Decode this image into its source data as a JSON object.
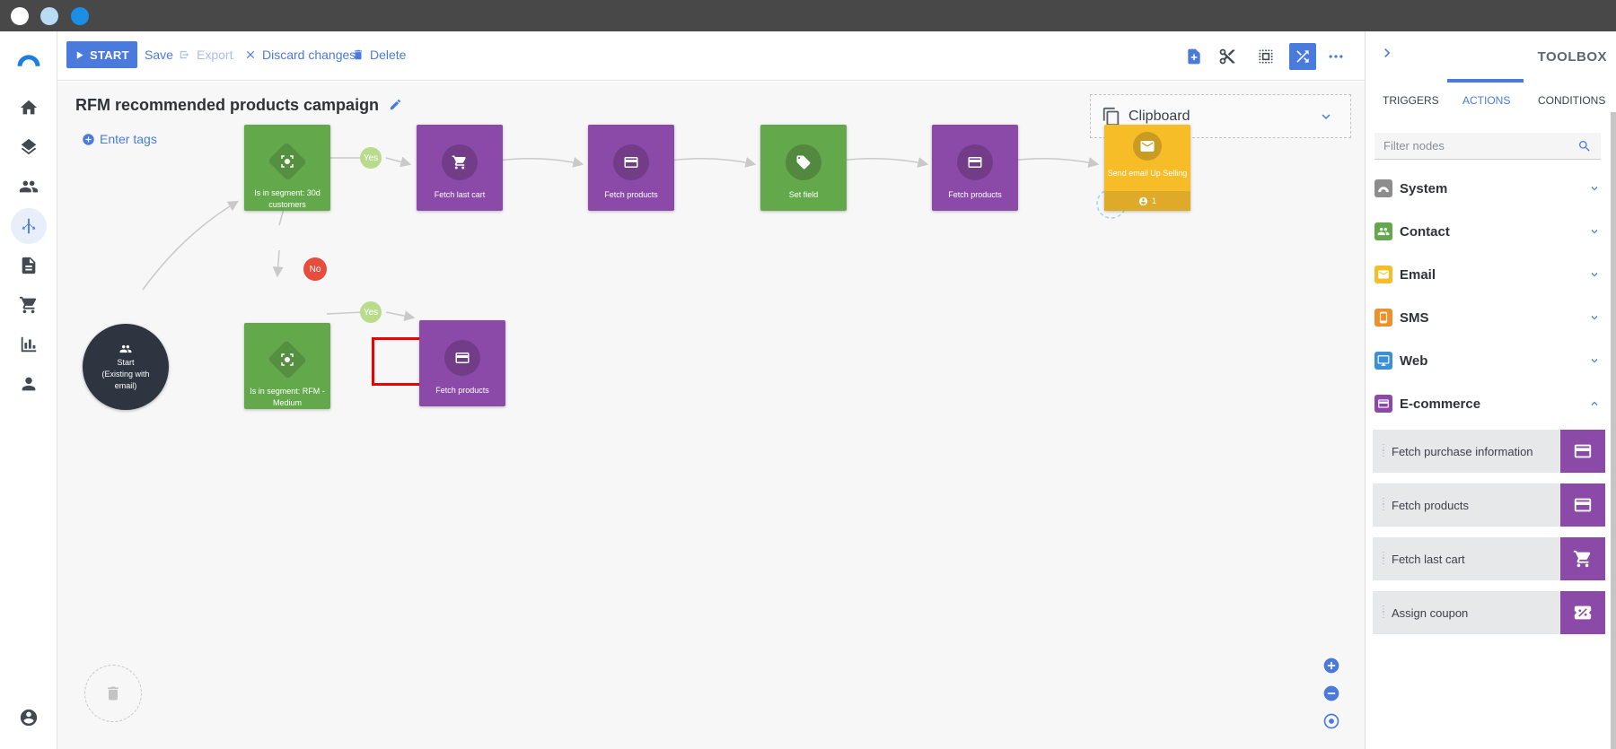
{
  "toolbar": {
    "start_label": "START",
    "save_label": "Save",
    "export_label": "Export",
    "discard_label": "Discard changes",
    "delete_label": "Delete"
  },
  "canvas": {
    "title": "RFM recommended products campaign",
    "enter_tags_label": "Enter tags",
    "clipboard_label": "Clipboard",
    "start_node_label": "Start",
    "start_node_sub": "(Existing with email)",
    "nodes": {
      "segment_30d": "Is in segment: 30d customers",
      "fetch_last_cart": "Fetch last cart",
      "fetch_products_1": "Fetch products",
      "set_field": "Set field",
      "fetch_products_2": "Fetch products",
      "send_email": "Send email Up Selling",
      "send_email_count": "1",
      "segment_rfm": "Is in segment: RFM - Medium",
      "fetch_products_3": "Fetch products"
    },
    "yes_label": "Yes",
    "no_label": "No"
  },
  "toolbox": {
    "title": "TOOLBOX",
    "tabs": [
      "TRIGGERS",
      "ACTIONS",
      "CONDITIONS"
    ],
    "filter_placeholder": "Filter nodes",
    "categories": [
      "System",
      "Contact",
      "Email",
      "SMS",
      "Web",
      "E-commerce"
    ],
    "ecommerce_items": [
      "Fetch purchase information",
      "Fetch products",
      "Fetch last cart",
      "Assign coupon"
    ]
  },
  "colors": {
    "accent": "#4a7bdc",
    "condition_green": "#64a84c",
    "action_purple": "#8b4aa8",
    "email_yellow": "#f6bd29",
    "no_red": "#e74c3c"
  }
}
